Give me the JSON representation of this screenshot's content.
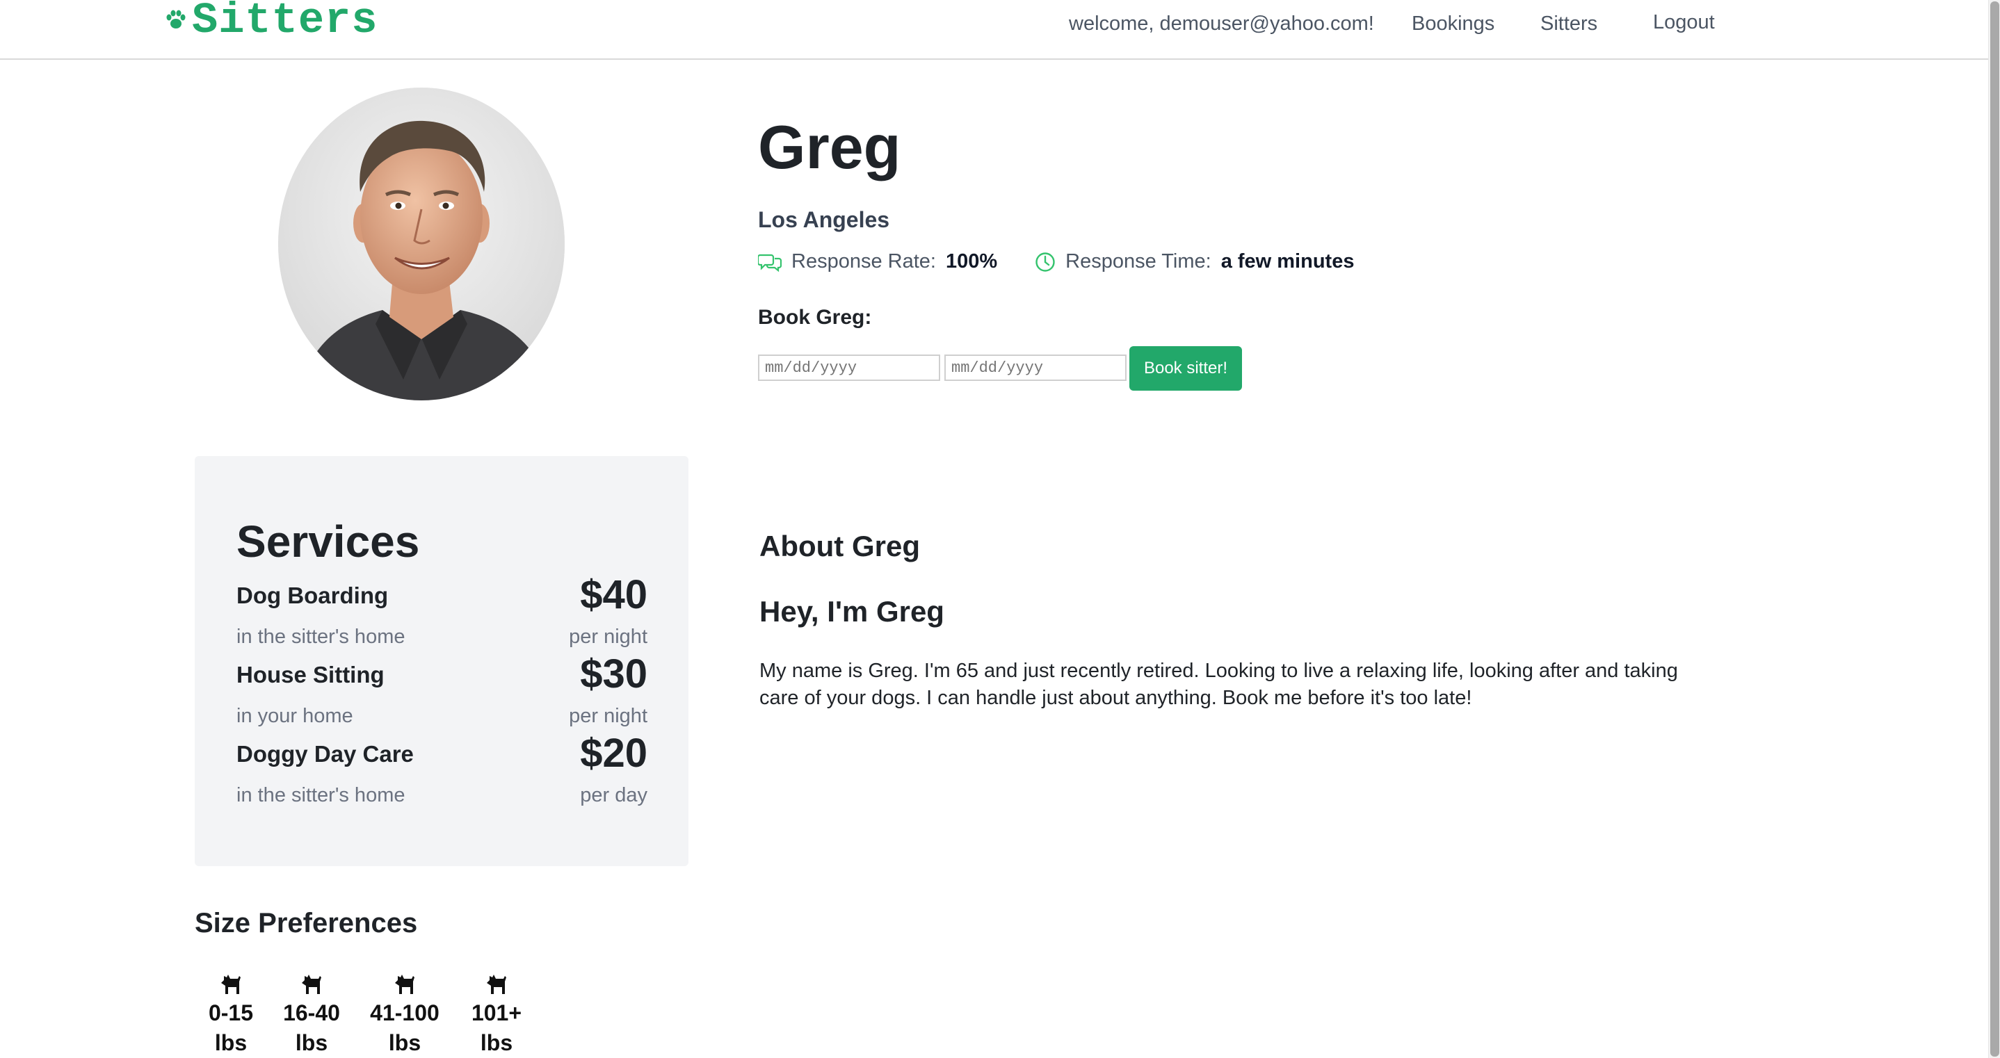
{
  "header": {
    "logo_text": "Sitters",
    "welcome": "welcome, demouser@yahoo.com!",
    "nav": [
      "Bookings",
      "Sitters",
      "Logout"
    ],
    "brand_color": "#22a86a"
  },
  "profile": {
    "name": "Greg",
    "city": "Los Angeles",
    "response_rate_label": "Response Rate:",
    "response_rate_value": "100%",
    "response_time_label": "Response Time:",
    "response_time_value": "a few minutes",
    "book_label": "Book Greg:",
    "start_date_placeholder": "mm/dd/yyyy",
    "end_date_placeholder": "mm/dd/yyyy",
    "book_button": "Book sitter!"
  },
  "services": {
    "title": "Services",
    "items": [
      {
        "name": "Dog Boarding",
        "location": "in the sitter's home",
        "price": "$40",
        "unit": "per night"
      },
      {
        "name": "House Sitting",
        "location": "in your home",
        "price": "$30",
        "unit": "per night"
      },
      {
        "name": "Doggy Day Care",
        "location": "in the sitter's home",
        "price": "$20",
        "unit": "per day"
      }
    ]
  },
  "about": {
    "title": "About Greg",
    "subtitle": "Hey, I'm Greg",
    "body": "My name is Greg. I'm 65 and just recently retired. Looking to live a relaxing life, looking after and taking care of your dogs. I can handle just about anything. Book me before it's too late!"
  },
  "size_preferences": {
    "title": "Size Preferences",
    "items": [
      {
        "range": "0-15",
        "unit": "lbs"
      },
      {
        "range": "16-40",
        "unit": "lbs"
      },
      {
        "range": "41-100",
        "unit": "lbs"
      },
      {
        "range": "101+",
        "unit": "lbs"
      }
    ]
  }
}
